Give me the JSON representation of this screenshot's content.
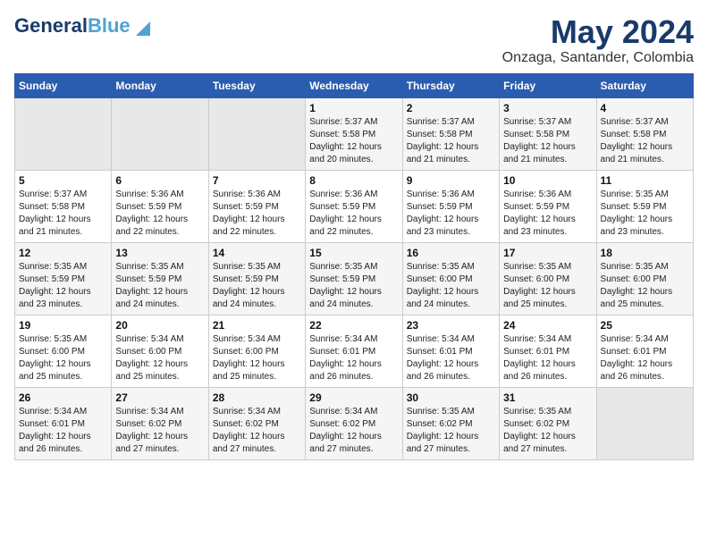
{
  "header": {
    "logo_general": "General",
    "logo_blue": "Blue",
    "title": "May 2024",
    "subtitle": "Onzaga, Santander, Colombia"
  },
  "days_of_week": [
    "Sunday",
    "Monday",
    "Tuesday",
    "Wednesday",
    "Thursday",
    "Friday",
    "Saturday"
  ],
  "weeks": [
    [
      {
        "day": "",
        "info": ""
      },
      {
        "day": "",
        "info": ""
      },
      {
        "day": "",
        "info": ""
      },
      {
        "day": "1",
        "info": "Sunrise: 5:37 AM\nSunset: 5:58 PM\nDaylight: 12 hours\nand 20 minutes."
      },
      {
        "day": "2",
        "info": "Sunrise: 5:37 AM\nSunset: 5:58 PM\nDaylight: 12 hours\nand 21 minutes."
      },
      {
        "day": "3",
        "info": "Sunrise: 5:37 AM\nSunset: 5:58 PM\nDaylight: 12 hours\nand 21 minutes."
      },
      {
        "day": "4",
        "info": "Sunrise: 5:37 AM\nSunset: 5:58 PM\nDaylight: 12 hours\nand 21 minutes."
      }
    ],
    [
      {
        "day": "5",
        "info": "Sunrise: 5:37 AM\nSunset: 5:58 PM\nDaylight: 12 hours\nand 21 minutes."
      },
      {
        "day": "6",
        "info": "Sunrise: 5:36 AM\nSunset: 5:59 PM\nDaylight: 12 hours\nand 22 minutes."
      },
      {
        "day": "7",
        "info": "Sunrise: 5:36 AM\nSunset: 5:59 PM\nDaylight: 12 hours\nand 22 minutes."
      },
      {
        "day": "8",
        "info": "Sunrise: 5:36 AM\nSunset: 5:59 PM\nDaylight: 12 hours\nand 22 minutes."
      },
      {
        "day": "9",
        "info": "Sunrise: 5:36 AM\nSunset: 5:59 PM\nDaylight: 12 hours\nand 23 minutes."
      },
      {
        "day": "10",
        "info": "Sunrise: 5:36 AM\nSunset: 5:59 PM\nDaylight: 12 hours\nand 23 minutes."
      },
      {
        "day": "11",
        "info": "Sunrise: 5:35 AM\nSunset: 5:59 PM\nDaylight: 12 hours\nand 23 minutes."
      }
    ],
    [
      {
        "day": "12",
        "info": "Sunrise: 5:35 AM\nSunset: 5:59 PM\nDaylight: 12 hours\nand 23 minutes."
      },
      {
        "day": "13",
        "info": "Sunrise: 5:35 AM\nSunset: 5:59 PM\nDaylight: 12 hours\nand 24 minutes."
      },
      {
        "day": "14",
        "info": "Sunrise: 5:35 AM\nSunset: 5:59 PM\nDaylight: 12 hours\nand 24 minutes."
      },
      {
        "day": "15",
        "info": "Sunrise: 5:35 AM\nSunset: 5:59 PM\nDaylight: 12 hours\nand 24 minutes."
      },
      {
        "day": "16",
        "info": "Sunrise: 5:35 AM\nSunset: 6:00 PM\nDaylight: 12 hours\nand 24 minutes."
      },
      {
        "day": "17",
        "info": "Sunrise: 5:35 AM\nSunset: 6:00 PM\nDaylight: 12 hours\nand 25 minutes."
      },
      {
        "day": "18",
        "info": "Sunrise: 5:35 AM\nSunset: 6:00 PM\nDaylight: 12 hours\nand 25 minutes."
      }
    ],
    [
      {
        "day": "19",
        "info": "Sunrise: 5:35 AM\nSunset: 6:00 PM\nDaylight: 12 hours\nand 25 minutes."
      },
      {
        "day": "20",
        "info": "Sunrise: 5:34 AM\nSunset: 6:00 PM\nDaylight: 12 hours\nand 25 minutes."
      },
      {
        "day": "21",
        "info": "Sunrise: 5:34 AM\nSunset: 6:00 PM\nDaylight: 12 hours\nand 25 minutes."
      },
      {
        "day": "22",
        "info": "Sunrise: 5:34 AM\nSunset: 6:01 PM\nDaylight: 12 hours\nand 26 minutes."
      },
      {
        "day": "23",
        "info": "Sunrise: 5:34 AM\nSunset: 6:01 PM\nDaylight: 12 hours\nand 26 minutes."
      },
      {
        "day": "24",
        "info": "Sunrise: 5:34 AM\nSunset: 6:01 PM\nDaylight: 12 hours\nand 26 minutes."
      },
      {
        "day": "25",
        "info": "Sunrise: 5:34 AM\nSunset: 6:01 PM\nDaylight: 12 hours\nand 26 minutes."
      }
    ],
    [
      {
        "day": "26",
        "info": "Sunrise: 5:34 AM\nSunset: 6:01 PM\nDaylight: 12 hours\nand 26 minutes."
      },
      {
        "day": "27",
        "info": "Sunrise: 5:34 AM\nSunset: 6:02 PM\nDaylight: 12 hours\nand 27 minutes."
      },
      {
        "day": "28",
        "info": "Sunrise: 5:34 AM\nSunset: 6:02 PM\nDaylight: 12 hours\nand 27 minutes."
      },
      {
        "day": "29",
        "info": "Sunrise: 5:34 AM\nSunset: 6:02 PM\nDaylight: 12 hours\nand 27 minutes."
      },
      {
        "day": "30",
        "info": "Sunrise: 5:35 AM\nSunset: 6:02 PM\nDaylight: 12 hours\nand 27 minutes."
      },
      {
        "day": "31",
        "info": "Sunrise: 5:35 AM\nSunset: 6:02 PM\nDaylight: 12 hours\nand 27 minutes."
      },
      {
        "day": "",
        "info": ""
      }
    ]
  ]
}
